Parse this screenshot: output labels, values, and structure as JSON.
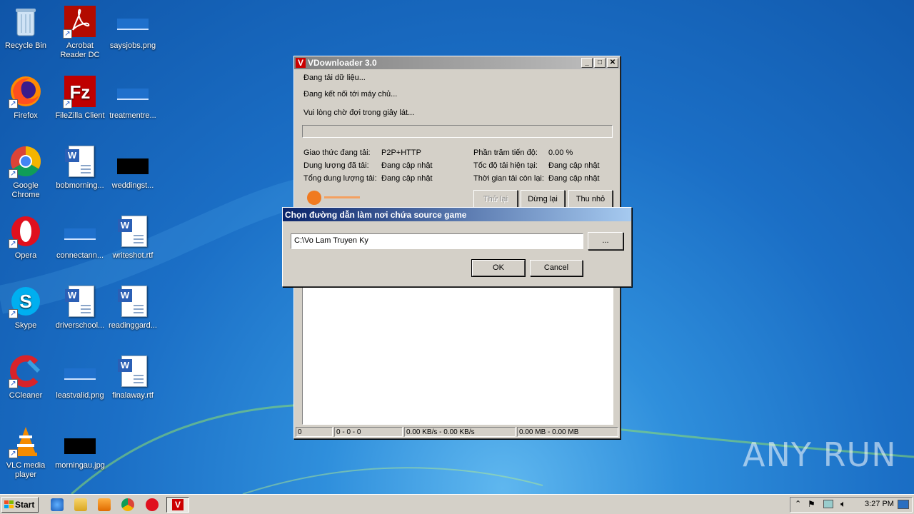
{
  "desktop": {
    "icons": [
      {
        "label": "Recycle Bin"
      },
      {
        "label": "Acrobat Reader DC"
      },
      {
        "label": "saysjobs.png"
      },
      {
        "label": "Firefox"
      },
      {
        "label": "FileZilla Client"
      },
      {
        "label": "treatmentre..."
      },
      {
        "label": "Google Chrome"
      },
      {
        "label": "bobmorning..."
      },
      {
        "label": "weddingst..."
      },
      {
        "label": "Opera"
      },
      {
        "label": "connectann..."
      },
      {
        "label": "writeshot.rtf"
      },
      {
        "label": "Skype"
      },
      {
        "label": "driverschool..."
      },
      {
        "label": "readinggard..."
      },
      {
        "label": "CCleaner"
      },
      {
        "label": "leastvalid.png"
      },
      {
        "label": "finalaway.rtf"
      },
      {
        "label": "VLC media player"
      },
      {
        "label": "morningau.jpg"
      }
    ]
  },
  "vdownloader": {
    "title": "VDownloader 3.0",
    "status_lines": [
      "Đang tải dữ liệu...",
      "Đang kết nối tới máy chủ...",
      "Vui lòng chờ đợi trong giây lát..."
    ],
    "progress": 0,
    "stats": {
      "protocol_label": "Giao thức đang tải:",
      "protocol_value": "P2P+HTTP",
      "downloaded_label": "Dung lượng đã tải:",
      "downloaded_value": "Đang cập nhật",
      "total_label": "Tổng dung lượng tải:",
      "total_value": "Đang cập nhật",
      "percent_label": "Phần trăm tiến độ:",
      "percent_value": "0.00 %",
      "speed_label": "Tốc độ tải hiện tại:",
      "speed_value": "Đang cập nhật",
      "remaining_label": "Thời gian tải còn lại:",
      "remaining_value": "Đang cập nhật"
    },
    "buttons": {
      "retry": "Thử lại",
      "stop": "Dừng lại",
      "minimize": "Thu nhỏ"
    },
    "statusbar": [
      "0",
      "0 - 0 - 0",
      "0.00 KB/s - 0.00 KB/s",
      "0.00 MB - 0.00 MB"
    ]
  },
  "dialog": {
    "title": "Chọn đường dẫn làm nơi chứa source game",
    "path_value": "C:\\Vo Lam Truyen Ky",
    "browse_label": "...",
    "ok_label": "OK",
    "cancel_label": "Cancel"
  },
  "taskbar": {
    "start_label": "Start",
    "clock": "3:27 PM"
  },
  "watermark": "ANY RUN"
}
